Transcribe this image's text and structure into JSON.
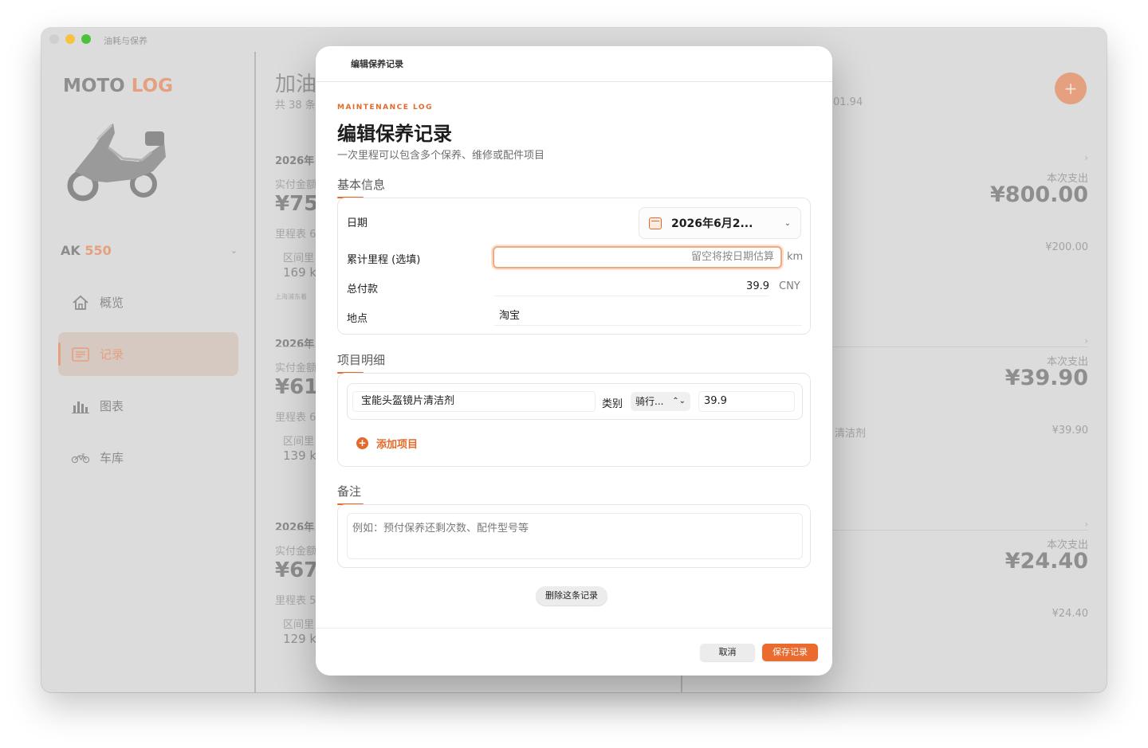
{
  "window": {
    "title": "油耗与保养",
    "traffic_colors": [
      "#cfcfcf",
      "#f6c23f",
      "#4cc13b"
    ]
  },
  "sidebar": {
    "logo_a": "MOTO ",
    "logo_b": "LOG",
    "vehicle_prefix": "AK ",
    "vehicle_num": "550",
    "chevron": "⌄",
    "items": [
      {
        "label": "概览",
        "icon": "house-icon"
      },
      {
        "label": "记录",
        "icon": "list-icon",
        "active": true
      },
      {
        "label": "图表",
        "icon": "bar-chart-icon"
      },
      {
        "label": "车库",
        "icon": "motorcycle-icon"
      }
    ]
  },
  "main": {
    "title": "加油",
    "subtitle": "共 38 条",
    "subtitle_right": "01.94",
    "add_symbol": "+",
    "records": [
      {
        "date": "2026年",
        "paid_label": "实付金额",
        "amount": "¥75",
        "odo": "里程表 6",
        "seg_label": "区间里",
        "seg_value": "169 km",
        "location": "上海浦东着",
        "arrow": "›",
        "spend_label": "本次支出",
        "spend": "¥800.00",
        "line_value": "¥200.00",
        "line_name": ""
      },
      {
        "date": "2026年",
        "paid_label": "实付金额",
        "amount": "¥61",
        "odo": "里程表 6",
        "seg_label": "区间里",
        "seg_value": "139 km",
        "location": "",
        "arrow": "›",
        "spend_label": "本次支出",
        "spend": "¥39.90",
        "line_value": "¥39.90",
        "line_name": "清洁剂"
      },
      {
        "date": "2026年",
        "paid_label": "实付金额",
        "amount": "¥67",
        "odo": "里程表 5",
        "seg_label": "区间里",
        "seg_value": "129 km",
        "location": "",
        "arrow": "›",
        "spend_label": "本次支出",
        "spend": "¥24.40",
        "line_value": "¥24.40",
        "line_name": ""
      }
    ]
  },
  "modal": {
    "header": "编辑保养记录",
    "eyebrow": "MAINTENANCE LOG",
    "title": "编辑保养记录",
    "subtitle": "一次里程可以包含多个保养、维修或配件项目",
    "basic": {
      "section": "基本信息",
      "date_label": "日期",
      "date_value": "2026年6月2...",
      "date_chevron": "⌄",
      "odo_label": "累计里程 (选填)",
      "odo_placeholder": "留空将按日期估算",
      "odo_unit": "km",
      "total_label": "总付款",
      "total_value": "39.9",
      "total_unit": "CNY",
      "place_label": "地点",
      "place_value": "淘宝"
    },
    "items": {
      "section": "项目明细",
      "rows": [
        {
          "name": "宝能头盔镜片清洁剂",
          "category_label": "类别",
          "category": "骑行...",
          "price": "39.9"
        }
      ],
      "add_label": "添加项目",
      "add_symbol": "+"
    },
    "notes": {
      "section": "备注",
      "placeholder": "例如：预付保养还剩次数、配件型号等"
    },
    "delete_label": "删除这条记录",
    "cancel_label": "取消",
    "save_label": "保存记录",
    "accent": "#e46a2c"
  }
}
